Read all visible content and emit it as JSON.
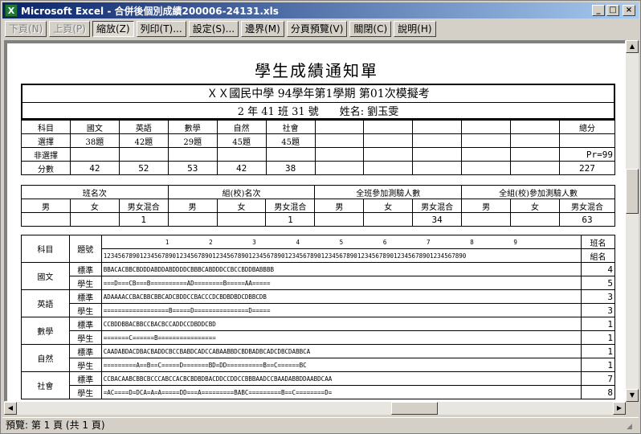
{
  "window": {
    "title": "Microsoft Excel - 合併後個別成績200006-24131.xls",
    "app_icon": "X",
    "minimize": "_",
    "maximize": "□",
    "close": "×"
  },
  "toolbar": {
    "next": "下頁(N)",
    "prev": "上頁(P)",
    "zoom": "縮放(Z)",
    "print": "列印(T)...",
    "setup": "設定(S)...",
    "margins": "邊界(M)",
    "page_break": "分頁預覽(V)",
    "close": "關閉(C)",
    "help": "說明(H)"
  },
  "status": "預覽: 第 1 頁 (共 1 頁)",
  "doc": {
    "title": "學生成績通知單",
    "exam": "ＸＸ國民中學 94學年第1學期 第01次模擬考",
    "student": "2 年 41 班 31 號　　姓名: 劉玉雯",
    "scores": {
      "subject_label": "科目",
      "subjects": [
        "國文",
        "英語",
        "數學",
        "自然",
        "社會"
      ],
      "total_label": "總分",
      "choice_label": "選擇",
      "choice": [
        "38題",
        "42題",
        "29題",
        "45題",
        "45題"
      ],
      "nonchoice_label": "非選擇",
      "pr": "Pr=99",
      "score_label": "分數",
      "score": [
        "42",
        "52",
        "53",
        "42",
        "38"
      ],
      "total": "227"
    },
    "rank": {
      "class_rank": "班名次",
      "group_rank": "組(校)名次",
      "class_count": "全班參加測驗人數",
      "group_count": "全組(校)參加測驗人數",
      "male": "男",
      "female": "女",
      "mixed": "男女混合",
      "class_rank_mixed": "1",
      "group_rank_mixed": "1",
      "class_count_mixed": "34",
      "group_count_mixed": "63"
    },
    "answers": {
      "subject_label": "科目",
      "question_label": "題號",
      "rank_label1": "班名",
      "rank_label2": "組名",
      "tens": "1           2           3           4           5           6           7           8           9",
      "ones": "1234567890123456789012345678901234567890123456789012345678901234567890123456789012345678901234567890",
      "std_label": "標準",
      "stu_label": "學生",
      "rows": [
        {
          "subject": "國文",
          "std": "BBACACBBCBDDDABDDABDDDDCBBBCABDDDCCBCCBDDBABBBB",
          "stu": "===D===CB===B==========AD========B=====AA=====",
          "r1": "4",
          "r2": "5"
        },
        {
          "subject": "英語",
          "std": "ADAAAACCBACBBCBBCADCBDDCCBACCCDCBDBDBDCDBBCDB",
          "stu": "==================B=====D===============D=====",
          "r1": "3",
          "r2": "3"
        },
        {
          "subject": "數學",
          "std": "CCBDDBBACBBCCBACBCCADDCCDBDDCBD",
          "stu": "=======C======B================",
          "r1": "1",
          "r2": "1"
        },
        {
          "subject": "自然",
          "std": "CAADABDACDBACBADDCBCCBABDCADCCABAABBDCBDBADBCADCDBCDABBCA",
          "stu": "=========A==B==C=====D=======BD=DD==========B==C======BC",
          "r1": "1",
          "r2": "1"
        },
        {
          "subject": "社會",
          "std": "CCBACAABCBBCBCCCABCCACBCBDBDBACDDCCDDCCBBBAADCCBAADABBDDAABDCAA",
          "stu": "=AC====D=DCA=A=A=====DD===A=========BABC=========B==C========D=",
          "r1": "7",
          "r2": "8"
        }
      ]
    }
  }
}
